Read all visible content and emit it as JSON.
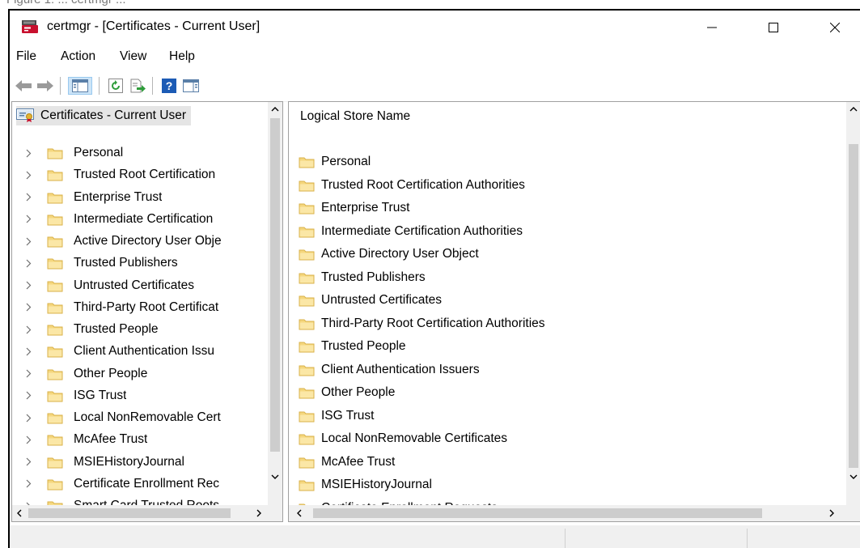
{
  "caption_fragment": "Figure 1: ... certmgr ...",
  "window": {
    "title": "certmgr - [Certificates - Current User]"
  },
  "menu": {
    "items": [
      "File",
      "Action",
      "View",
      "Help"
    ]
  },
  "toolbar": {
    "icons": [
      "back-arrow-icon",
      "forward-arrow-icon",
      "show-hide-console-tree-icon",
      "refresh-icon",
      "export-list-icon",
      "help-icon",
      "properties-icon"
    ]
  },
  "tree": {
    "root_label": "Certificates - Current User",
    "items": [
      "Personal",
      "Trusted Root Certification",
      "Enterprise Trust",
      "Intermediate Certification",
      "Active Directory User Obje",
      "Trusted Publishers",
      "Untrusted Certificates",
      "Third-Party Root Certificat",
      "Trusted People",
      "Client Authentication Issu",
      "Other People",
      "ISG Trust",
      "Local NonRemovable Cert",
      "McAfee Trust",
      "MSIEHistoryJournal",
      "Certificate Enrollment Rec",
      "Smart Card Trusted Roots"
    ]
  },
  "list": {
    "column_header": "Logical Store Name",
    "items": [
      "Personal",
      "Trusted Root Certification Authorities",
      "Enterprise Trust",
      "Intermediate Certification Authorities",
      "Active Directory User Object",
      "Trusted Publishers",
      "Untrusted Certificates",
      "Third-Party Root Certification Authorities",
      "Trusted People",
      "Client Authentication Issuers",
      "Other People",
      "ISG Trust",
      "Local NonRemovable Certificates",
      "McAfee Trust",
      "MSIEHistoryJournal",
      "Certificate Enrollment Requests"
    ]
  },
  "status": {
    "panel1": "",
    "panel2": "",
    "panel3": ""
  },
  "colors": {
    "folder_fill": "#f5d77e",
    "folder_edge": "#d9b24a",
    "selection": "#e5e5e5",
    "scrollbar_track": "#f0f0f0",
    "scrollbar_thumb": "#cdcdcd"
  }
}
